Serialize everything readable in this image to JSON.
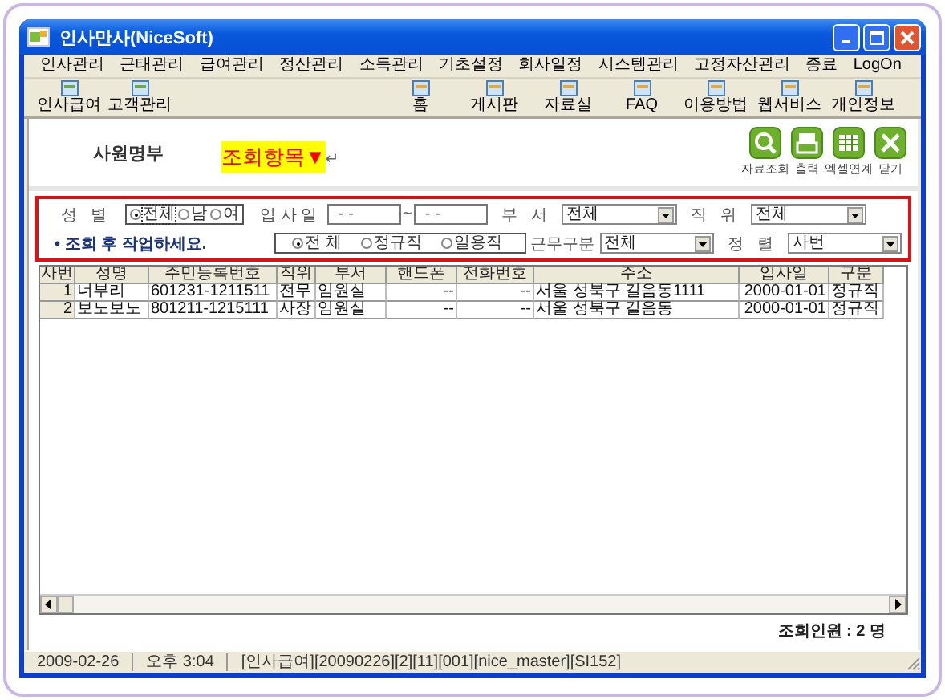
{
  "window": {
    "title": "인사만사(NiceSoft)"
  },
  "menu": [
    {
      "label": "인사관리"
    },
    {
      "label": "근태관리"
    },
    {
      "label": "급여관리"
    },
    {
      "label": "정산관리"
    },
    {
      "label": "소득관리"
    },
    {
      "label": "기초설정"
    },
    {
      "label": "회사일정"
    },
    {
      "label": "시스템관리"
    },
    {
      "label": "고정자산관리"
    },
    {
      "label": "종료"
    },
    {
      "label": "LogOn"
    }
  ],
  "toolbar_left": [
    {
      "label": "인사급여"
    },
    {
      "label": "고객관리"
    }
  ],
  "toolbar_right": [
    {
      "label": "홈"
    },
    {
      "label": "게시판"
    },
    {
      "label": "자료실"
    },
    {
      "label": "FAQ"
    },
    {
      "label": "이용방법"
    },
    {
      "label": "웹서비스"
    },
    {
      "label": "개인정보"
    }
  ],
  "page": {
    "title": "사원명부",
    "annotation": "조회항목▼",
    "annotation_mark": "↵"
  },
  "actions": [
    {
      "label": "자료조회",
      "kind": "search"
    },
    {
      "label": "출력",
      "kind": "print"
    },
    {
      "label": "엑셀연계",
      "kind": "excel"
    },
    {
      "label": "닫기",
      "kind": "close"
    }
  ],
  "filters": {
    "gender": {
      "label": "성   별",
      "options": [
        {
          "label": "전체",
          "selected": true
        },
        {
          "label": "남",
          "selected": false
        },
        {
          "label": "여",
          "selected": false
        }
      ]
    },
    "hire_date": {
      "label": "입 사 일",
      "from": "- -",
      "separator": "~",
      "to": "- -"
    },
    "department": {
      "label": "부   서",
      "value": "전체"
    },
    "position": {
      "label": "직   위",
      "value": "전체"
    },
    "note": "• 조회 후 작업하세요.",
    "employment": {
      "options": [
        {
          "label": "전 체",
          "selected": true
        },
        {
          "label": "정규직",
          "selected": false
        },
        {
          "label": "일용직",
          "selected": false
        }
      ]
    },
    "work_type": {
      "label": "근무구분",
      "value": "전체"
    },
    "sort": {
      "label": "정   렬",
      "value": "사번"
    }
  },
  "table": {
    "columns": [
      "사번",
      "성명",
      "주민등록번호",
      "직위",
      "부서",
      "핸드폰",
      "전화번호",
      "주소",
      "입사일",
      "구분"
    ],
    "rows": [
      [
        "1",
        "너부리",
        "601231-1211511",
        "전무",
        "임원실",
        "--",
        "--",
        "서울 성북구 길음동1111",
        "2000-01-01",
        "정규직"
      ],
      [
        "2",
        "보노보노",
        "801211-1215111",
        "사장",
        "임원실",
        "--",
        "--",
        "서울 성북구 길음동",
        "2000-01-01",
        "정규직"
      ]
    ]
  },
  "count": "조회인원 : 2 명",
  "status_bar": [
    "2009-02-26",
    "오후 3:04",
    "[인사급여][20090226][2][11][001][nice_master][SI152]"
  ]
}
